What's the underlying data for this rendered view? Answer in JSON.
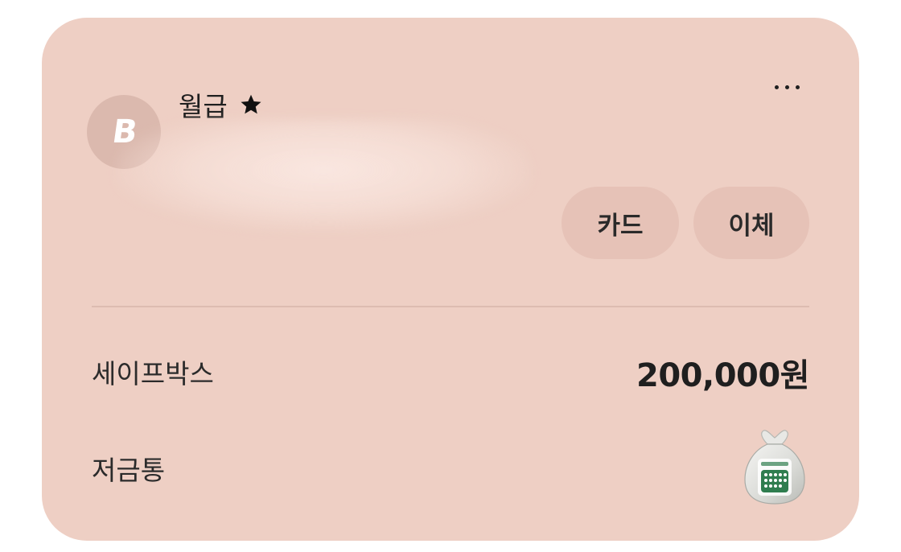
{
  "account": {
    "bank_logo_letter": "B",
    "name": "월급",
    "favorite_icon": "star-icon"
  },
  "header": {
    "more_icon": "more-horizontal-icon"
  },
  "actions": {
    "card_label": "카드",
    "transfer_label": "이체"
  },
  "rows": {
    "safebox_label": "세이프박스",
    "safebox_amount": "200,000원",
    "piggy_label": "저금통",
    "piggy_icon": "savings-bag-icon"
  },
  "colors": {
    "card_background": "#eecfc4",
    "pill_background": "#e6c2b7",
    "logo_background": "#dbb9ae",
    "text_primary": "#1f1f1f"
  }
}
